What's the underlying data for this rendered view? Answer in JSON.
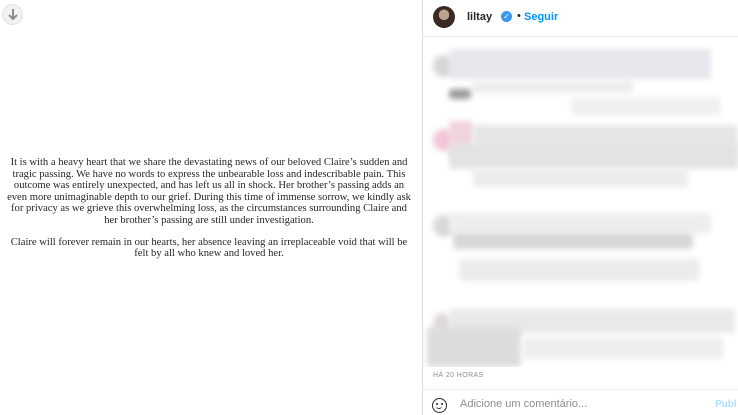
{
  "post": {
    "paragraphs": [
      "It is with a heavy heart that we share the devastating news of our beloved Claire’s sudden and tragic passing. We have no words to express the unbearable loss and indescribable pain. This outcome was entirely unexpected, and has left us all in shock. Her brother’s passing adds an even more unimaginable depth to our grief. During this time of immense sorrow, we kindly ask for privacy as we grieve this overwhelming loss, as the circumstances surrounding Claire and her brother’s passing are still under investigation.",
      "Claire will forever remain in our hearts, her absence leaving an irreplaceable void that will be felt by all who knew and loved her."
    ],
    "download_icon": "arrow-down-icon"
  },
  "header": {
    "username": "liltay",
    "verified_icon": "verified-badge-icon",
    "separator": "•",
    "follow_label": "Seguir"
  },
  "footer": {
    "timestamp": "HÁ 20 HORAS",
    "comment_placeholder": "Adicione um comentário...",
    "publish_label": "Publ"
  },
  "colors": {
    "accent": "#0095f6",
    "verified": "#3897f0",
    "muted": "#8e8e8e",
    "divider": "#dbdbdb"
  }
}
